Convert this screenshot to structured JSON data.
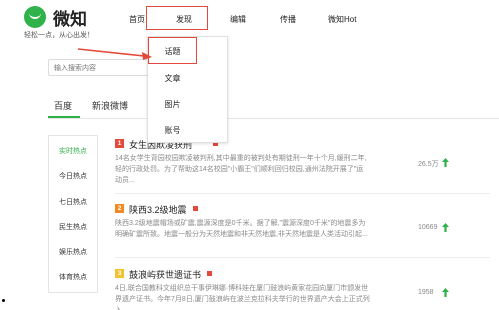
{
  "logo": {
    "name": "微知",
    "slogan": "轻松一点，从心出发！"
  },
  "nav": {
    "home": "首页",
    "discover": "发现",
    "edit": "编辑",
    "spread": "传播",
    "hot": "微知Hot"
  },
  "dropdown": {
    "items": [
      "话题",
      "文章",
      "图片",
      "账号"
    ]
  },
  "search": {
    "placeholder": "输入搜索内容"
  },
  "tabs": [
    "百度",
    "新浪微博"
  ],
  "sidebar": {
    "items": [
      "实时热点",
      "今日热点",
      "七日热点",
      "民生热点",
      "娱乐热点",
      "体育热点"
    ],
    "active": "实时热点"
  },
  "entries": [
    {
      "rank": "1",
      "rank_color": "#e34a3a",
      "title": "女生因欺凌获刑",
      "desc": "14名女学生背园校园欺凌被判刑,其中最重的被判处有期徒刑一年十个月,缓刑二年,轻的行政处罚。为了帮助这14名校园\"小霸王\"们顺利回归校园,通州法院开展了\"运动员...",
      "count": "26.5万"
    },
    {
      "rank": "2",
      "rank_color": "#f08a24",
      "title": "陕西3.2级地震",
      "desc": "陕西3.2级地震帽场或矿震,震源深度是0千米。据了解,\"震源深度0千米\"的地震多为明确矿震所致。地震一般分为天然地震和非天然地震,非天然地震是人类活动引起...",
      "count": "10669"
    },
    {
      "rank": "3",
      "rank_color": "#f2c230",
      "title": "鼓浪屿获世遗证书",
      "desc": "4日,联合国教科文组织总干事伊琳娜·博科娃在厦门鼓浪屿黄家花园向厦门市颁发世界遗产证书。今年7月8日,厦门鼓浪屿在波兰克拉科夫举行的世界遗产大会上正式列入...",
      "count": "1958"
    }
  ],
  "colors": {
    "accent_green": "#2fb24a",
    "highlight_red": "#e34a3a"
  }
}
